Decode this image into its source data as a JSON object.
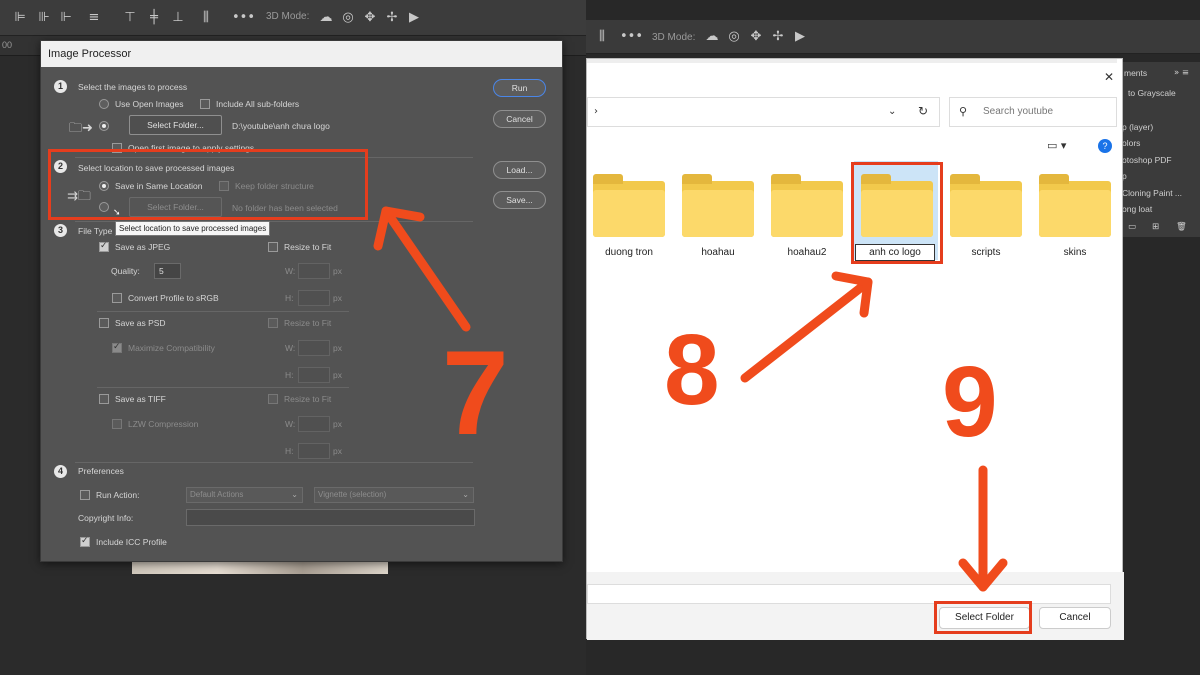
{
  "toolbar": {
    "mode_label": "3D Mode:"
  },
  "ruler_label": "00",
  "dialog": {
    "title": "Image Processor",
    "section1": {
      "num": "1",
      "heading": "Select the images to process",
      "use_open": "Use Open Images",
      "include_sub": "Include All sub-folders",
      "select_folder": "Select Folder...",
      "path": "D:\\youtube\\anh chưa logo",
      "open_first": "Open first image to apply settings"
    },
    "section2": {
      "num": "2",
      "heading": "Select location to save processed images",
      "same_location": "Save in Same Location",
      "keep_structure": "Keep folder structure",
      "select_folder": "Select Folder...",
      "no_folder": "No folder has been selected",
      "tooltip": "Select location to save processed images"
    },
    "section3": {
      "num": "3",
      "heading": "File Type",
      "jpeg": "Save as JPEG",
      "resize": "Resize to Fit",
      "quality_label": "Quality:",
      "quality_value": "5",
      "w": "W:",
      "h": "H:",
      "px": "px",
      "convert": "Convert Profile to sRGB",
      "psd": "Save as PSD",
      "max_compat": "Maximize Compatibility",
      "tiff": "Save as TIFF",
      "lzw": "LZW Compression"
    },
    "section4": {
      "num": "4",
      "heading": "Preferences",
      "run_action": "Run Action:",
      "default_actions": "Default Actions",
      "vignette": "Vignette (selection)",
      "copyright": "Copyright Info:",
      "icc": "Include ICC Profile"
    },
    "buttons": {
      "run": "Run",
      "cancel": "Cancel",
      "load": "Load...",
      "save": "Save..."
    }
  },
  "picker": {
    "search_placeholder": "Search youtube",
    "help": "?",
    "folders": [
      "duong tron",
      "hoahau",
      "hoahau2",
      "anh co logo",
      "scripts",
      "skins"
    ],
    "select_folder": "Select Folder",
    "cancel": "Cancel"
  },
  "right_panel": {
    "tab": "ments",
    "items": [
      "to Grayscale",
      "p (layer)",
      "olors",
      "otoshop PDF",
      "p",
      "Cloning Paint ...",
      "ong loat"
    ]
  },
  "annotations": {
    "seven": "7",
    "eight": "8",
    "nine": "9"
  },
  "colors": {
    "annotation": "#f04b1c",
    "dialog_bg": "#535353",
    "accent": "#1a73e8"
  }
}
